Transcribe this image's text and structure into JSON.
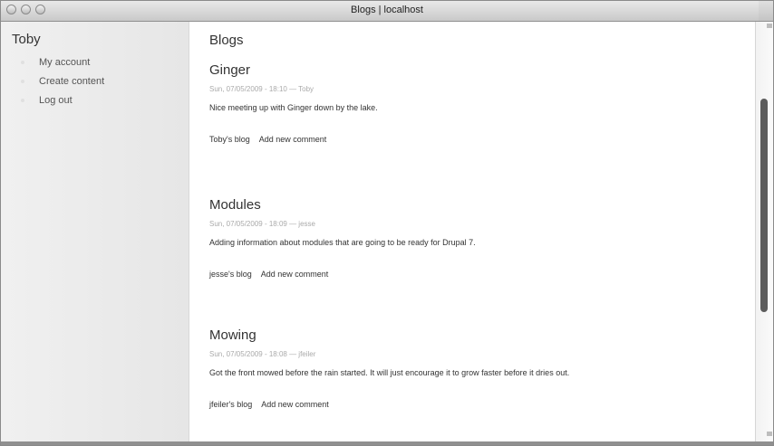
{
  "window": {
    "title": "Blogs | localhost"
  },
  "sidebar": {
    "user_name": "Toby",
    "items": [
      {
        "label": "My account"
      },
      {
        "label": "Create content"
      },
      {
        "label": "Log out"
      }
    ]
  },
  "main": {
    "page_title": "Blogs",
    "posts": [
      {
        "title": "Ginger",
        "meta": "Sun, 07/05/2009 - 18:10 — Toby",
        "body": "Nice meeting up with Ginger down by the lake.",
        "blog_link": "Toby's blog",
        "comment_link": "Add new comment"
      },
      {
        "title": "Modules",
        "meta": "Sun, 07/05/2009 - 18:09 — jesse",
        "body": "Adding information about modules that are going to be ready for Drupal 7.",
        "blog_link": "jesse's blog",
        "comment_link": "Add new comment"
      },
      {
        "title": "Mowing",
        "meta": "Sun, 07/05/2009 - 18:08 — jfeiler",
        "body": "Got the front mowed before the rain started. It will just encourage it to grow faster before it dries out.",
        "blog_link": "jfeiler's blog",
        "comment_link": "Add new comment"
      }
    ]
  }
}
